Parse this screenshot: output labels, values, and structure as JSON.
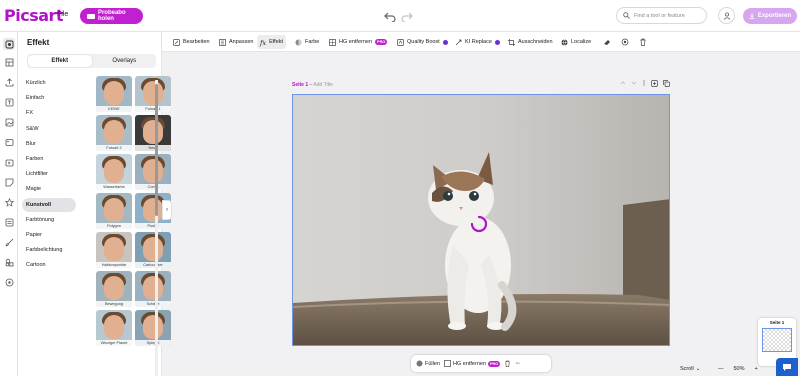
{
  "app": {
    "logo": "Picsart",
    "file_menu": "File",
    "trial_button": "Probeabo holen",
    "search_placeholder": "Find a tool or feature",
    "export_button": "Exportieren"
  },
  "panel": {
    "title": "Effekt",
    "tabs": [
      {
        "label": "Effekt",
        "active": true
      },
      {
        "label": "Overlays",
        "active": false
      }
    ],
    "categories": [
      {
        "label": "Kürzlich",
        "active": false
      },
      {
        "label": "Einfach",
        "active": false
      },
      {
        "label": "FX",
        "active": false
      },
      {
        "label": "S&W",
        "active": false
      },
      {
        "label": "Blur",
        "active": false
      },
      {
        "label": "Farben",
        "active": false
      },
      {
        "label": "Lichtfilter",
        "active": false
      },
      {
        "label": "Magie",
        "active": false
      },
      {
        "label": "Kunstvoll",
        "active": true
      },
      {
        "label": "Farbtönung",
        "active": false
      },
      {
        "label": "Papier",
        "active": false
      },
      {
        "label": "Farbbelichtung",
        "active": false
      },
      {
        "label": "Cartoon",
        "active": false
      }
    ],
    "thumbnails": [
      "KEINE",
      "Fotoart 1",
      "Fotoart 2",
      "Neon",
      "Wasserfarbe",
      "Comic",
      "Polygon",
      "Poster",
      "Halbtonpunkte",
      "Cartoonizer",
      "Bewegung",
      "Schärfe",
      "Winziger Planet",
      "Spiegel"
    ]
  },
  "toolbar": {
    "items": [
      {
        "label": "Bearbeiten",
        "icon": "edit-icon"
      },
      {
        "label": "Anpassen",
        "icon": "adjust-icon"
      },
      {
        "label": "Effekt",
        "icon": "fx-icon",
        "active": true
      },
      {
        "label": "Farbe",
        "icon": "color-icon"
      },
      {
        "label": "HG entfernen",
        "icon": "remove-bg-icon",
        "badge": "PRO"
      },
      {
        "label": "Quality Boost",
        "icon": "quality-boost-icon"
      },
      {
        "label": "KI Replace",
        "icon": "ai-replace-icon"
      },
      {
        "label": "Ausschneiden",
        "icon": "crop-icon"
      },
      {
        "label": "Localize",
        "icon": "localize-icon"
      }
    ]
  },
  "canvas": {
    "page_label": "Seite 1",
    "title_placeholder": "Add Title"
  },
  "bottombar": {
    "fill_label": "Füllen",
    "remove_bg_label": "HG entfernen",
    "remove_bg_badge": "PRO"
  },
  "footer": {
    "scroll_label": "Scroll",
    "zoom_value": "50%",
    "pages_title": "Seite 1"
  },
  "colors": {
    "brand": "#b014c8",
    "button": "#c020d0",
    "selection": "#6e94e6"
  }
}
